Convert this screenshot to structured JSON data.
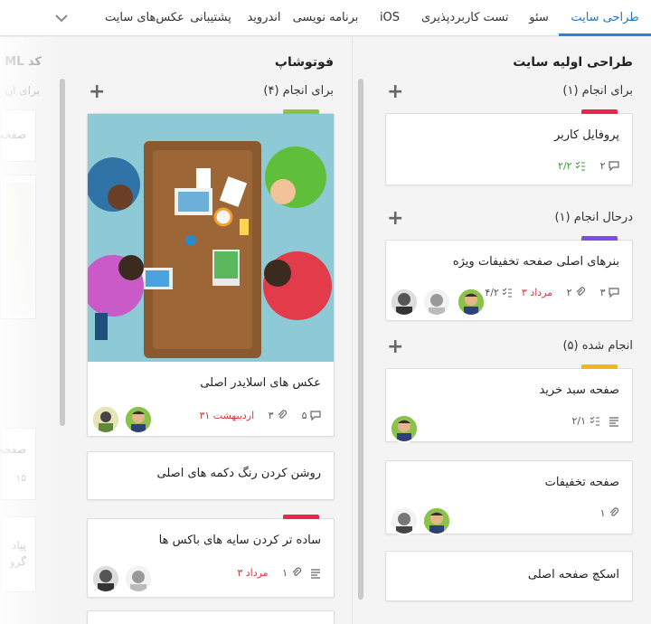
{
  "tabs": [
    {
      "label": "طراحی سایت",
      "active": true
    },
    {
      "label": "سئو"
    },
    {
      "label": "تست کاربردپذیری"
    },
    {
      "label": "iOS"
    },
    {
      "label": "برنامه نویسی"
    },
    {
      "label": "اندروید"
    },
    {
      "label": "پشتیبانی"
    },
    {
      "label": "عکس‌های سایت"
    }
  ],
  "columns": {
    "right": {
      "title": "طراحی اولیه سایت",
      "groups": [
        {
          "title": "برای انجام (۱)",
          "cards": [
            {
              "title": "پروفایل کاربر",
              "label_color": "#e8264f",
              "comments": "۲",
              "checklist": "۲/۲"
            }
          ]
        },
        {
          "title": "درحال انجام (۱)",
          "cards": [
            {
              "title": "بنرهای اصلی صفحه تخفیفات ویژه",
              "label_color": "#7b4fe6",
              "comments": "۳",
              "attachments": "۲",
              "date": "مرداد ۳",
              "checklist": "۴/۲"
            }
          ]
        },
        {
          "title": "انجام شده (۵)",
          "cards": [
            {
              "title": "صفحه سبد خرید",
              "label_color": "#f2b51b",
              "checklist": "۲/۱"
            },
            {
              "title": "صفحه تخفیفات",
              "attachments": "۱"
            },
            {
              "title": "اسکچ صفحه اصلی"
            }
          ]
        }
      ]
    },
    "middle": {
      "title": "فوتوشاپ",
      "group_title": "برای انجام (۴)",
      "cards": [
        {
          "title": "عکس های اسلایدر اصلی",
          "label_color": "#8bc34a",
          "comments": "۵",
          "attachments": "۳",
          "date": "اردیبهشت ۳۱"
        },
        {
          "title": "روشن کردن رنگ دکمه های اصلی"
        },
        {
          "title": "ساده تر کردن سایه های باکس ها",
          "label_color": "#e8264f",
          "attachments": "۱",
          "date": "مرداد ۳"
        }
      ]
    },
    "left": {
      "title_fragment": "کد ML",
      "group_fragment": "برای ان",
      "card_fragment_1": "صفحه",
      "card_fragment_2": "صفحه",
      "card_fragment_3": "۱۵",
      "card_fragment_4": "پیاد",
      "card_fragment_5": "گرو"
    }
  },
  "colors": {
    "accent": "#2d82d2",
    "date_red": "#d23a3a",
    "check_green": "#3a9a3a"
  },
  "icons": [
    "chevron-down-icon",
    "plus-icon",
    "comment-icon",
    "attachment-icon",
    "checklist-icon",
    "description-icon"
  ]
}
